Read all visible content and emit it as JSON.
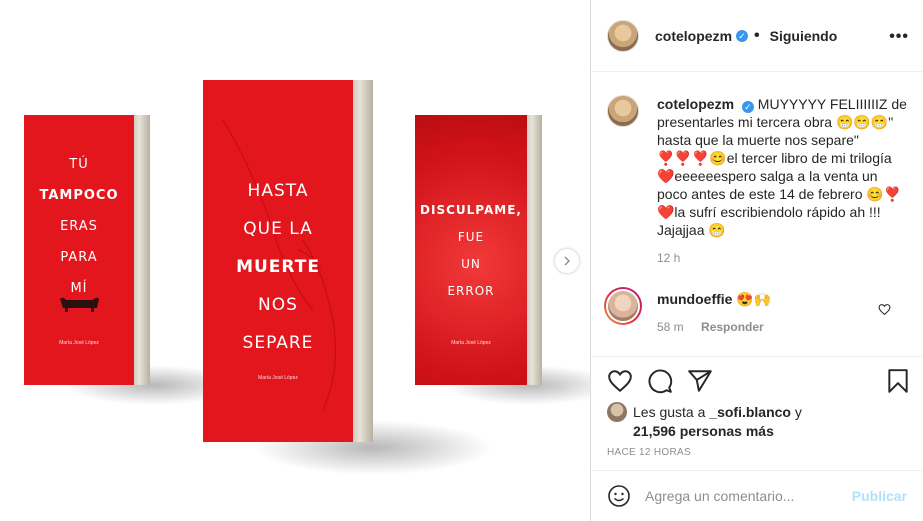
{
  "post": {
    "books": [
      {
        "lines": [
          {
            "text": "TÚ",
            "strong": false
          },
          {
            "text": "TAMPOCO",
            "strong": true
          },
          {
            "text": "ERAS",
            "strong": false
          },
          {
            "text": "PARA",
            "strong": false
          },
          {
            "text": "MÍ",
            "strong": false
          }
        ],
        "author": "María José López"
      },
      {
        "lines": [
          {
            "text": "HASTA",
            "strong": false
          },
          {
            "text": "QUE LA",
            "strong": false
          },
          {
            "text": "MUERTE",
            "strong": true
          },
          {
            "text": "NOS",
            "strong": false
          },
          {
            "text": "SEPARE",
            "strong": false
          }
        ],
        "author": "María José López"
      },
      {
        "lines": [
          {
            "text": "DISCULPAME,",
            "strong": true
          },
          {
            "text": "FUE",
            "strong": false
          },
          {
            "text": "UN",
            "strong": false
          },
          {
            "text": "ERROR",
            "strong": false
          }
        ],
        "author": "María José López"
      }
    ],
    "cover_color": "#e3151d",
    "next_icon": "chevron-right-icon"
  },
  "header": {
    "username": "cotelopezm",
    "separator": "•",
    "follow_label": "Siguiendo",
    "more_icon": "more-icon"
  },
  "caption": {
    "username": "cotelopezm",
    "text": "MUYYYYY FELIIIIIIZ de presentarles mi tercera obra 😁😁😁\" hasta que la muerte nos separe\" ❣️❣️❣️😊el tercer libro de mi trilogía ❤️eeeeeespero salga a la venta un poco antes de este 14 de febrero 😊❣️❤️la sufrí escribiendolo rápido ah !!! Jajajjaa 😁",
    "age": "12 h"
  },
  "comment": {
    "username": "mundoeffie",
    "text": "😍🙌",
    "age": "58 m",
    "reply_label": "Responder"
  },
  "likes": {
    "prefix": "Les gusta a",
    "first_user": "_sofi.blanco",
    "joiner": "y",
    "count_text": "21,596 personas más"
  },
  "timestamp": "HACE 12 HORAS",
  "composer": {
    "placeholder": "Agrega un comentario...",
    "publish_label": "Publicar"
  },
  "colors": {
    "verified": "#3897f0",
    "publish_disabled": "#b2dffc",
    "muted_text": "#8e8e8e"
  }
}
